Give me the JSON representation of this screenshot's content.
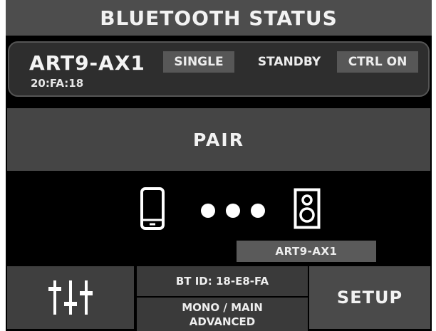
{
  "header": {
    "title": "BLUETOOTH STATUS"
  },
  "device": {
    "name": "ART9-AX1",
    "mac": "20:FA:18",
    "mode": "SINGLE",
    "state": "STANDBY",
    "ctrl": "CTRL ON"
  },
  "pair_button": {
    "label": "PAIR"
  },
  "connection": {
    "source_icon": "phone-icon",
    "link_icon": "dots-icon",
    "target_icon": "speaker-icon",
    "target_label": "ART9-AX1"
  },
  "bottom": {
    "mixer_icon": "mixer-sliders-icon",
    "bt_id": "BT ID: 18-E8-FA",
    "route_line1": "MONO / MAIN",
    "route_line2": "ADVANCED",
    "setup_label": "SETUP"
  },
  "colors": {
    "background": "#000000",
    "panel": "#2e2e2e",
    "button": "#454545",
    "chip": "#575757",
    "text": "#f2f2f2"
  }
}
